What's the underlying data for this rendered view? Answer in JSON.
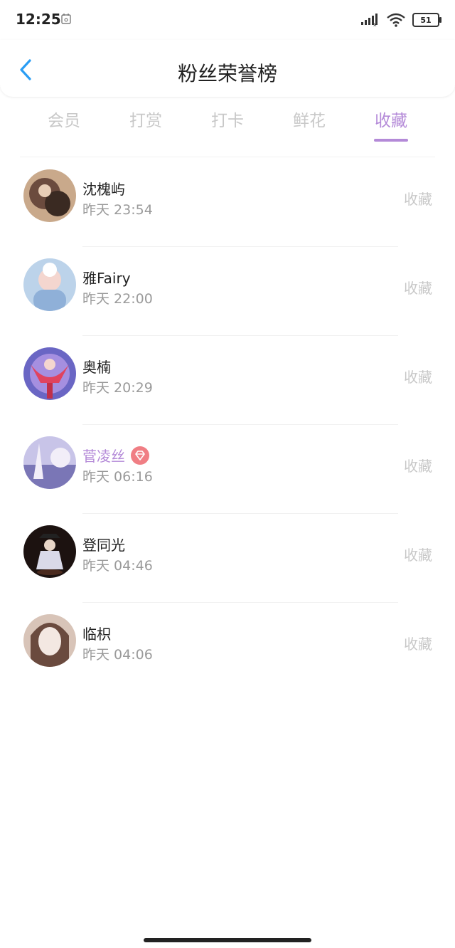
{
  "status_bar": {
    "time": "12:25",
    "battery": "51"
  },
  "header": {
    "title": "粉丝荣誉榜"
  },
  "tabs": [
    {
      "label": "会员",
      "active": false
    },
    {
      "label": "打赏",
      "active": false
    },
    {
      "label": "打卡",
      "active": false
    },
    {
      "label": "鲜花",
      "active": false
    },
    {
      "label": "收藏",
      "active": true
    }
  ],
  "fans": [
    {
      "name": "沈槐屿",
      "time": "昨天 23:54",
      "action": "收藏",
      "vip": false,
      "avatar_colors": [
        "#6b4b3e",
        "#c9a98b",
        "#3a2a22"
      ]
    },
    {
      "name": "雅Fairy",
      "time": "昨天 22:00",
      "action": "收藏",
      "vip": false,
      "avatar_colors": [
        "#bcd3ea",
        "#f4d6cf",
        "#8fb0d8"
      ]
    },
    {
      "name": "奥楠",
      "time": "昨天 20:29",
      "action": "收藏",
      "vip": false,
      "avatar_colors": [
        "#6a66c4",
        "#e0435f",
        "#a58fe0"
      ]
    },
    {
      "name": "菅凌丝",
      "time": "昨天 06:16",
      "action": "收藏",
      "vip": true,
      "avatar_colors": [
        "#c8c4e8",
        "#7a76b6",
        "#f2eef8"
      ]
    },
    {
      "name": "登同光",
      "time": "昨天 04:46",
      "action": "收藏",
      "vip": false,
      "avatar_colors": [
        "#1c1210",
        "#d9d9e8",
        "#4a2a1e"
      ]
    },
    {
      "name": "临枳",
      "time": "昨天 04:06",
      "action": "收藏",
      "vip": false,
      "avatar_colors": [
        "#d8c4b8",
        "#f3e8e2",
        "#6a4a3e"
      ]
    }
  ],
  "colors": {
    "accent": "#b48ad8",
    "inactive": "#c8c8c8",
    "back_arrow": "#2a9df4",
    "vip_badge": "#f07e84"
  },
  "icons": {
    "back": "chevron-left-icon",
    "vip": "diamond-icon",
    "wifi": "wifi-icon",
    "signal": "signal-icon",
    "battery": "battery-icon",
    "calendar": "calendar-icon"
  }
}
